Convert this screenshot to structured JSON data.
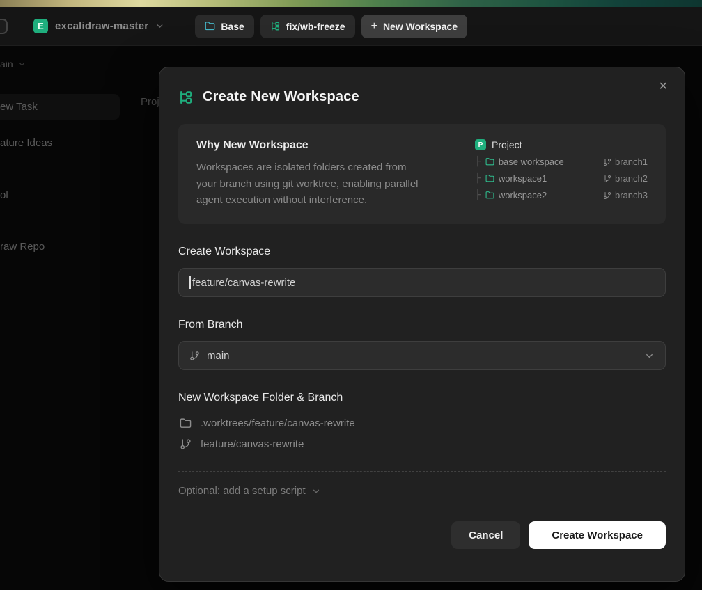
{
  "colors": {
    "accent": "#1fae7d",
    "base_icon": "#45b8c9",
    "tree_folder": "#2fbd8e",
    "submit_bg": "#ffffff",
    "submit_text": "#191919"
  },
  "icons": {
    "plus": "+",
    "close": "✕",
    "tree_connector": "├"
  },
  "header": {
    "repo_badge": "E",
    "repo_name": "excalidraw-master",
    "base_button_label": "Base",
    "branch_button_label": "fix/wb-freeze",
    "new_workspace_button_label": "New Workspace"
  },
  "sidebar": {
    "branch_label": "ain",
    "items": [
      "ew Task",
      "ature Ideas",
      "ol",
      "raw Repo"
    ]
  },
  "background": {
    "column_label": "Proj"
  },
  "modal": {
    "title": "Create New Workspace",
    "info": {
      "heading": "Why New Workspace",
      "body": "Workspaces are isolated folders created from your branch using git worktree, enabling parallel agent execution without interference.",
      "tree": {
        "root_badge": "P",
        "root_label": "Project",
        "rows": [
          {
            "folder": "base workspace",
            "branch": "branch1"
          },
          {
            "folder": "workspace1",
            "branch": "branch2"
          },
          {
            "folder": "workspace2",
            "branch": "branch3"
          }
        ]
      }
    },
    "name_label": "Create Workspace",
    "name_value": "feature/canvas-rewrite",
    "branch_label": "From Branch",
    "branch_value": "main",
    "preview_label": "New Workspace Folder & Branch",
    "preview_folder": ".worktrees/feature/canvas-rewrite",
    "preview_branch": "feature/canvas-rewrite",
    "optional_label": "Optional: add a setup script",
    "cancel_label": "Cancel",
    "submit_label": "Create Workspace"
  }
}
